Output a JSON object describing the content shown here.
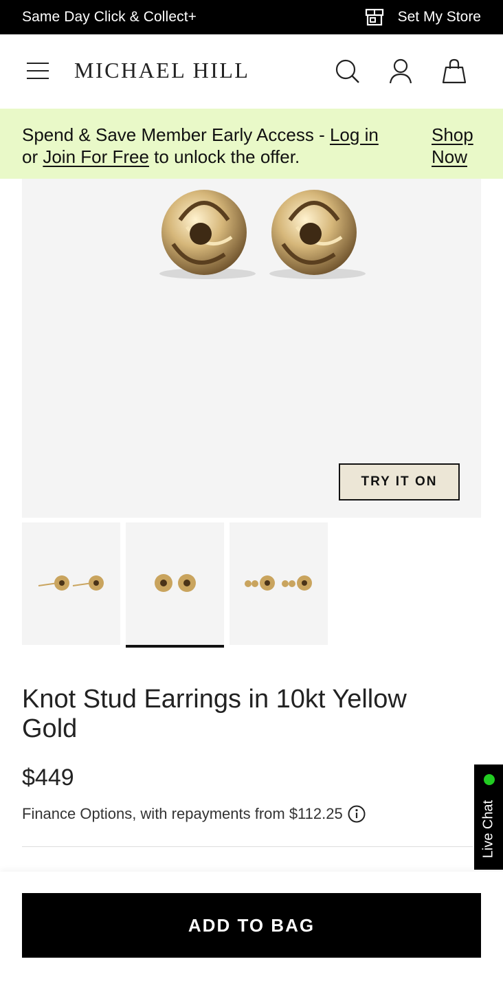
{
  "topbar": {
    "left_text": "Same Day Click & Collect+",
    "store_label": "Set My Store",
    "store_icon": "store-icon"
  },
  "header": {
    "logo": "MICHAEL HILL",
    "icons": [
      "menu-icon",
      "search-icon",
      "account-icon",
      "bag-icon"
    ]
  },
  "promo": {
    "text_1": "Spend & Save Member Early Access - ",
    "login_link": "Log in",
    "text_2": " or ",
    "join_link": "Join For Free",
    "text_3": " to unlock the offer.",
    "shop_now_1": "Shop",
    "shop_now_2": "Now",
    "background": "#e9f9c8"
  },
  "product": {
    "try_it_on": "TRY IT ON",
    "thumbnails_count": 3,
    "active_thumbnail": 2,
    "title": "Knot Stud Earrings in 10kt Yellow Gold",
    "price": "$449",
    "finance": "Finance Options, with repayments from $112.25"
  },
  "livechat": {
    "label": "Live Chat",
    "status_color": "#22cc22"
  },
  "cta": {
    "add_to_bag": "ADD TO BAG"
  }
}
